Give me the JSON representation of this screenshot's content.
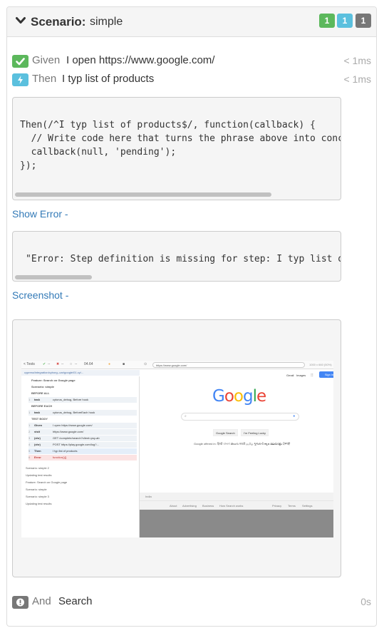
{
  "scenario": {
    "keyword": "Scenario:",
    "name": "simple",
    "badges": {
      "passed": "1",
      "pending": "1",
      "failed": "1"
    }
  },
  "steps": [
    {
      "keyword": "Given",
      "text": "I open https://www.google.com/",
      "duration": "< 1ms",
      "status": "passed",
      "icon": "check-icon"
    },
    {
      "keyword": "Then",
      "text": "I typ list of products",
      "duration": "< 1ms",
      "status": "pending",
      "icon": "bolt-icon"
    }
  ],
  "snippet": {
    "lines": [
      "Then(/^I typ list of products$/, function(callback) {",
      "  // Write code here that turns the phrase above into concrete actions",
      "  callback(null, 'pending');",
      "});"
    ]
  },
  "show_error_label": "Show Error -",
  "error_text": "\"Error: Step definition is missing for step: I typ list of products\"",
  "screenshot_label": "Screenshot -",
  "final_step": {
    "keyword": "And",
    "text": "Search",
    "duration": "0s",
    "status": "skipped",
    "icon": "exclamation-icon"
  },
  "screenshot": {
    "runner": {
      "tests_label": "< Tests",
      "passed": "--",
      "failed": "--",
      "pending": "--",
      "time": "04.64",
      "spec_path": "cypress/integration/cyborg--car/google/01.cy/...",
      "commands": [
        {
          "n": "",
          "cmd": "Feature: Search on Google page",
          "arg": ""
        },
        {
          "n": "",
          "cmd": "Scenario: simple",
          "arg": ""
        },
        {
          "n": "",
          "cmd": "BEFORE ALL",
          "arg": ""
        },
        {
          "n": "1",
          "cmd": "task",
          "arg": "cytorus_debug, Before hook"
        },
        {
          "n": "",
          "cmd": "BEFORE EACH",
          "arg": ""
        },
        {
          "n": "1",
          "cmd": "task",
          "arg": "cytorus_debug, BeforeEach hook"
        },
        {
          "n": "",
          "cmd": "TEST BODY",
          "arg": ""
        },
        {
          "n": "1",
          "cmd": "Given",
          "arg": "I open https://www.google.com/"
        },
        {
          "n": "2",
          "cmd": "visit",
          "arg": "https://www.google.com/"
        },
        {
          "n": "3",
          "cmd": "(xhr)",
          "arg": "GET /complete/search?client=psy-ab"
        },
        {
          "n": "4",
          "cmd": "(xhr)",
          "arg": "POST https://play.google.com/log?..."
        },
        {
          "n": "5",
          "cmd": "Then",
          "arg": "I typ list of products"
        },
        {
          "n": "6",
          "cmd": "Error",
          "arg": "function(){}"
        }
      ],
      "sidebar_after": [
        "Scenario: simple 2",
        "Updating test results",
        "Feature: Search on Google page",
        "Scenario: simple",
        "Scenario: simple 3",
        "Updating test results"
      ]
    },
    "browser": {
      "url": "https://www.google.com/",
      "viewport": "1000 x 660 (50%)",
      "top_links": [
        "Gmail",
        "Images"
      ],
      "signin": "Sign in",
      "logo": "Google",
      "buttons": [
        "Google Search",
        "I'm Feeling Lucky"
      ],
      "offered_in": "Google offered in: हिन्दी বাংলা తెలుగు मराठी தமிழ் ગુજરાતી ಕನ್ನಡ മലയാളം ਪੰਜਾਬੀ",
      "country": "India",
      "footer_left": [
        "About",
        "Advertising",
        "Business",
        "How Search works"
      ],
      "footer_right": [
        "Privacy",
        "Terms",
        "Settings"
      ]
    }
  },
  "colors": {
    "passed": "#5cb85c",
    "pending": "#5bc0de",
    "skipped": "#777777",
    "link": "#337ab7"
  }
}
